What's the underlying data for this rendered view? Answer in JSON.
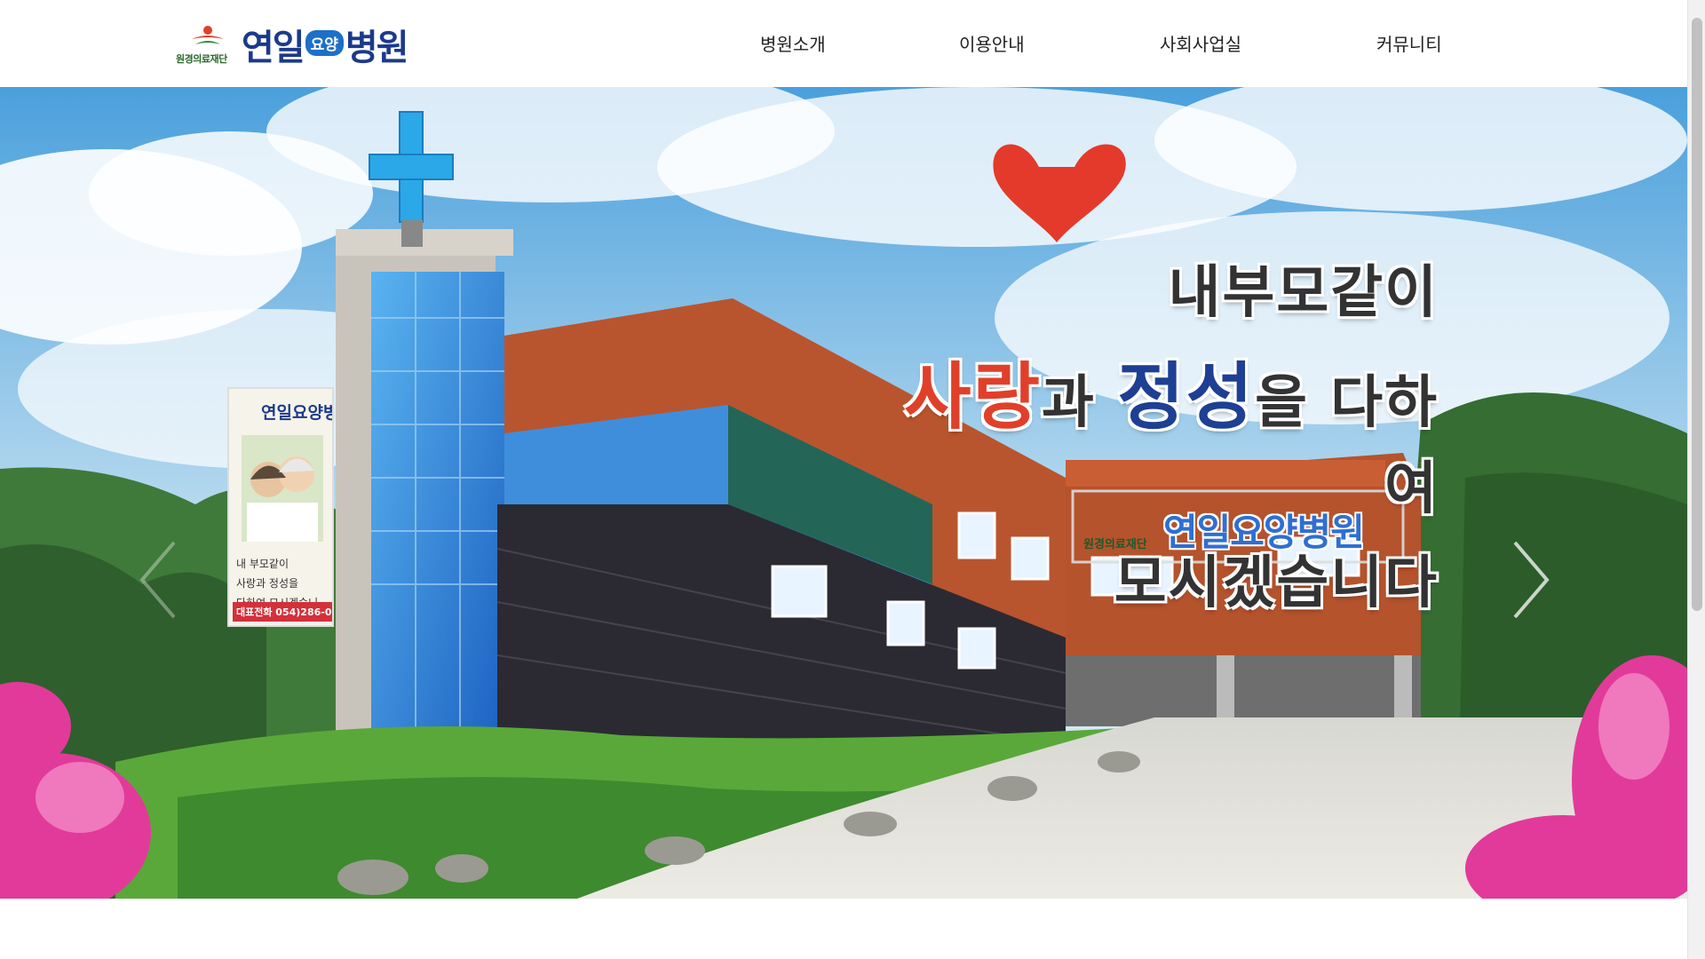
{
  "header": {
    "logo": {
      "foundation": "원경의료재단",
      "name_part1": "연일",
      "badge": "요양",
      "name_part2": "병원"
    },
    "nav": [
      {
        "label": "병원소개"
      },
      {
        "label": "이용안내"
      },
      {
        "label": "사회사업실"
      },
      {
        "label": "커뮤니티"
      }
    ]
  },
  "hero": {
    "slogan": {
      "line1": "내부모같이",
      "love": "사랑",
      "and": "과 ",
      "sincere": "정성",
      "line2_rest": "을 다하여",
      "line3": "모시겠습니다"
    },
    "building_sign": {
      "text": "연일요양병원",
      "sub": "원경의료재단"
    },
    "banner": {
      "title": "연일요양병원",
      "copy_line1": "내 부모같이",
      "copy_line2": "사랑과 정성을",
      "copy_line3": "다하여 모시겠습니",
      "phone": "대표전화 054)286-05"
    },
    "slide_count": 3,
    "active_slide": 1
  },
  "colors": {
    "brand_blue": "#1b3a8a",
    "accent_blue": "#1e7ac8",
    "love_red": "#e0402a",
    "cross_blue": "#2aa8e8"
  }
}
